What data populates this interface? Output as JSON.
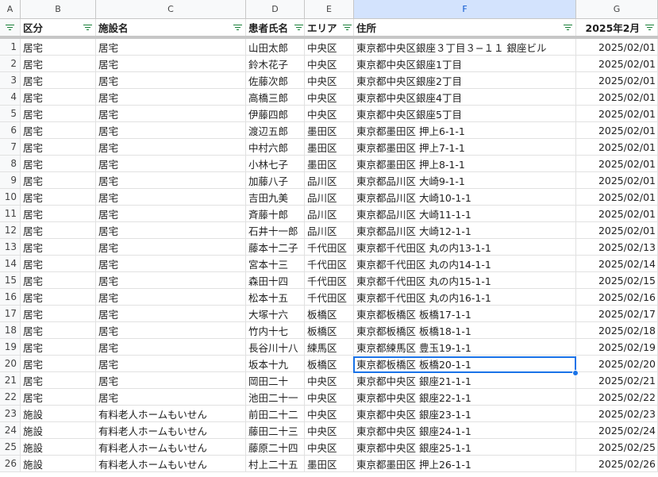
{
  "column_letters": [
    "A",
    "B",
    "C",
    "D",
    "E",
    "F",
    "G"
  ],
  "header": {
    "category": "区分",
    "facility": "施設名",
    "patient": "患者氏名",
    "area": "エリア",
    "address": "住所",
    "month": "2025年2月"
  },
  "rows": [
    {
      "n": "1",
      "category": "居宅",
      "facility": "居宅",
      "patient": "山田太郎",
      "area": "中央区",
      "address": "東京都中央区銀座３丁目３−１１ 銀座ビル",
      "date": "2025/02/01"
    },
    {
      "n": "2",
      "category": "居宅",
      "facility": "居宅",
      "patient": "鈴木花子",
      "area": "中央区",
      "address": "東京都中央区銀座1丁目",
      "date": "2025/02/01"
    },
    {
      "n": "3",
      "category": "居宅",
      "facility": "居宅",
      "patient": "佐藤次郎",
      "area": "中央区",
      "address": "東京都中央区銀座2丁目",
      "date": "2025/02/01"
    },
    {
      "n": "4",
      "category": "居宅",
      "facility": "居宅",
      "patient": "高橋三郎",
      "area": "中央区",
      "address": "東京都中央区銀座4丁目",
      "date": "2025/02/01"
    },
    {
      "n": "5",
      "category": "居宅",
      "facility": "居宅",
      "patient": "伊藤四郎",
      "area": "中央区",
      "address": "東京都中央区銀座5丁目",
      "date": "2025/02/01"
    },
    {
      "n": "6",
      "category": "居宅",
      "facility": "居宅",
      "patient": "渡辺五郎",
      "area": "墨田区",
      "address": "東京都墨田区 押上6-1-1",
      "date": "2025/02/01"
    },
    {
      "n": "7",
      "category": "居宅",
      "facility": "居宅",
      "patient": "中村六郎",
      "area": "墨田区",
      "address": "東京都墨田区 押上7-1-1",
      "date": "2025/02/01"
    },
    {
      "n": "8",
      "category": "居宅",
      "facility": "居宅",
      "patient": "小林七子",
      "area": "墨田区",
      "address": "東京都墨田区 押上8-1-1",
      "date": "2025/02/01"
    },
    {
      "n": "9",
      "category": "居宅",
      "facility": "居宅",
      "patient": "加藤八子",
      "area": "品川区",
      "address": "東京都品川区 大崎9-1-1",
      "date": "2025/02/01"
    },
    {
      "n": "10",
      "category": "居宅",
      "facility": "居宅",
      "patient": "吉田九美",
      "area": "品川区",
      "address": "東京都品川区 大崎10-1-1",
      "date": "2025/02/01"
    },
    {
      "n": "11",
      "category": "居宅",
      "facility": "居宅",
      "patient": "斉藤十郎",
      "area": "品川区",
      "address": "東京都品川区 大崎11-1-1",
      "date": "2025/02/01"
    },
    {
      "n": "12",
      "category": "居宅",
      "facility": "居宅",
      "patient": "石井十一郎",
      "area": "品川区",
      "address": "東京都品川区 大崎12-1-1",
      "date": "2025/02/01"
    },
    {
      "n": "13",
      "category": "居宅",
      "facility": "居宅",
      "patient": "藤本十二子",
      "area": "千代田区",
      "address": "東京都千代田区 丸の内13-1-1",
      "date": "2025/02/13"
    },
    {
      "n": "14",
      "category": "居宅",
      "facility": "居宅",
      "patient": "宮本十三",
      "area": "千代田区",
      "address": "東京都千代田区 丸の内14-1-1",
      "date": "2025/02/14"
    },
    {
      "n": "15",
      "category": "居宅",
      "facility": "居宅",
      "patient": "森田十四",
      "area": "千代田区",
      "address": "東京都千代田区 丸の内15-1-1",
      "date": "2025/02/15"
    },
    {
      "n": "16",
      "category": "居宅",
      "facility": "居宅",
      "patient": "松本十五",
      "area": "千代田区",
      "address": "東京都千代田区 丸の内16-1-1",
      "date": "2025/02/16"
    },
    {
      "n": "17",
      "category": "居宅",
      "facility": "居宅",
      "patient": "大塚十六",
      "area": "板橋区",
      "address": "東京都板橋区 板橋17-1-1",
      "date": "2025/02/17"
    },
    {
      "n": "18",
      "category": "居宅",
      "facility": "居宅",
      "patient": "竹内十七",
      "area": "板橋区",
      "address": "東京都板橋区 板橋18-1-1",
      "date": "2025/02/18"
    },
    {
      "n": "19",
      "category": "居宅",
      "facility": "居宅",
      "patient": "長谷川十八",
      "area": "練馬区",
      "address": "東京都練馬区 豊玉19-1-1",
      "date": "2025/02/19"
    },
    {
      "n": "20",
      "category": "居宅",
      "facility": "居宅",
      "patient": "坂本十九",
      "area": "板橋区",
      "address": "東京都板橋区 板橋20-1-1",
      "date": "2025/02/20"
    },
    {
      "n": "21",
      "category": "居宅",
      "facility": "居宅",
      "patient": "岡田二十",
      "area": "中央区",
      "address": "東京都中央区 銀座21-1-1",
      "date": "2025/02/21"
    },
    {
      "n": "22",
      "category": "居宅",
      "facility": "居宅",
      "patient": "池田二十一",
      "area": "中央区",
      "address": "東京都中央区 銀座22-1-1",
      "date": "2025/02/22"
    },
    {
      "n": "23",
      "category": "施設",
      "facility": "有料老人ホームもいせん",
      "patient": "前田二十二",
      "area": "中央区",
      "address": "東京都中央区 銀座23-1-1",
      "date": "2025/02/23"
    },
    {
      "n": "24",
      "category": "施設",
      "facility": "有料老人ホームもいせん",
      "patient": "藤田二十三",
      "area": "中央区",
      "address": "東京都中央区 銀座24-1-1",
      "date": "2025/02/24"
    },
    {
      "n": "25",
      "category": "施設",
      "facility": "有料老人ホームもいせん",
      "patient": "藤原二十四",
      "area": "中央区",
      "address": "東京都中央区 銀座25-1-1",
      "date": "2025/02/25"
    },
    {
      "n": "26",
      "category": "施設",
      "facility": "有料老人ホームもいせん",
      "patient": "村上二十五",
      "area": "墨田区",
      "address": "東京都墨田区 押上26-1-1",
      "date": "2025/02/26"
    }
  ],
  "selected_cell": "F20"
}
